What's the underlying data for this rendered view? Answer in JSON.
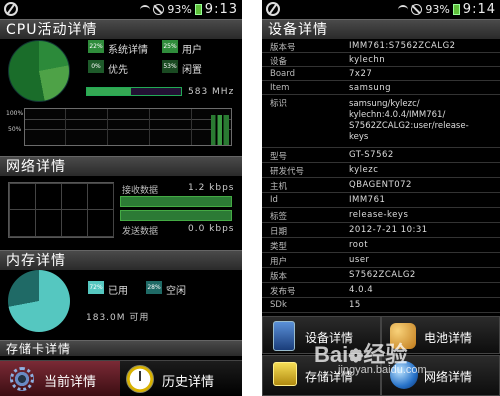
{
  "left": {
    "statusbar": {
      "battery": "93%",
      "time": "9:13"
    },
    "cpu": {
      "title": "CPU活动详情",
      "legend": [
        {
          "pct": "22%",
          "label": "系统详情"
        },
        {
          "pct": "25%",
          "label": "用户"
        },
        {
          "pct": "0%",
          "label": "优先"
        },
        {
          "pct": "53%",
          "label": "闲置"
        }
      ],
      "usage_fraction": 0.47,
      "frequency": "583 MHz",
      "graph_max": "100%",
      "graph_mid": "50%"
    },
    "network": {
      "title": "网络详情",
      "recv_label": "接收数据",
      "recv_value": "1.2 kbps",
      "send_label": "发送数据",
      "send_value": "0.0 kbps"
    },
    "memory": {
      "title": "内存详情",
      "used_pct": "72%",
      "used_label": "已用",
      "free_pct": "28%",
      "free_label": "空闲",
      "total": "183.0M 可用"
    },
    "storage": {
      "title": "存储卡详情"
    },
    "tabs": {
      "current": "当前详情",
      "history": "历史详情"
    }
  },
  "right": {
    "statusbar": {
      "battery": "93%",
      "time": "9:14"
    },
    "title": "设备详情",
    "rows": [
      {
        "key": "版本号",
        "value": "IMM761:S7562ZCALG2"
      },
      {
        "key": "设备",
        "value": "kylechn"
      },
      {
        "key": "Board",
        "value": "7x27"
      },
      {
        "key": "Item",
        "value": "samsung"
      }
    ],
    "fingerprint": {
      "key": "标识",
      "lines": [
        "samsung/kylezc/",
        "kylechn:4.0.4/IMM761/",
        "S7562ZCALG2:user/release-",
        "keys"
      ]
    },
    "rows2": [
      {
        "key": "型号",
        "value": "GT-S7562"
      },
      {
        "key": "研发代号",
        "value": "kylezc"
      },
      {
        "key": "主机",
        "value": "QBAGENT072"
      },
      {
        "key": "Id",
        "value": "IMM761"
      },
      {
        "key": "标签",
        "value": "release-keys"
      },
      {
        "key": "日期",
        "value": "2012-7-21 10:31"
      },
      {
        "key": "类型",
        "value": "root"
      },
      {
        "key": "用户",
        "value": "user"
      },
      {
        "key": "版本",
        "value": "S7562ZCALG2"
      },
      {
        "key": "发布号",
        "value": "4.0.4"
      },
      {
        "key": "SDk",
        "value": "15"
      }
    ],
    "grid": {
      "device": "设备详情",
      "battery": "电池详情",
      "storage": "存储详情",
      "network": "网络详情"
    }
  },
  "watermark": {
    "brand": "Bai",
    "brand2": "经验",
    "url": "jingyan.baidu.com"
  }
}
